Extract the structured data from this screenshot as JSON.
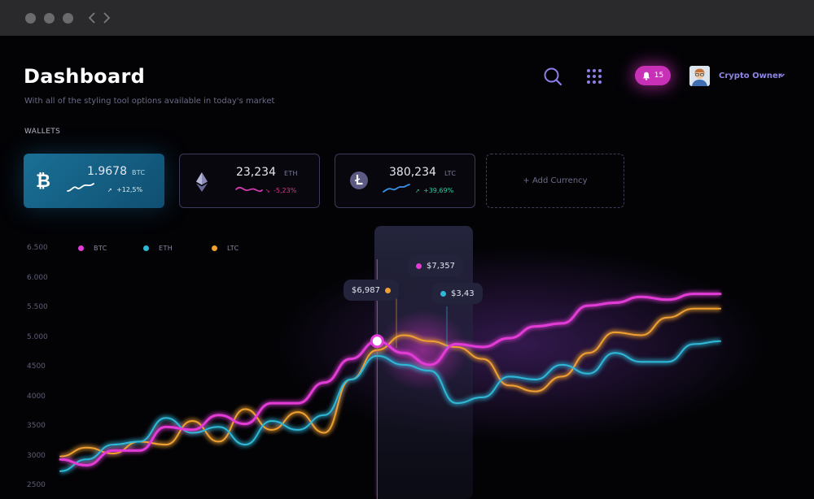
{
  "window": {
    "controls": [
      "close",
      "minimize",
      "maximize"
    ],
    "nav": [
      "back",
      "forward"
    ]
  },
  "header": {
    "title": "Dashboard",
    "subtitle": "With all of the styling tool options available in today's market",
    "search_icon": "search-icon",
    "apps_icon": "grid-icon",
    "notifications": {
      "icon": "bell-icon",
      "count": "15"
    },
    "user": {
      "name": "Crypto Owner",
      "avatar": "user-avatar"
    }
  },
  "wallets": {
    "label": "WALLETS",
    "items": [
      {
        "amount": "1.9678",
        "symbol": "BTC",
        "change": "+12,5%",
        "direction": "up",
        "icon": "bitcoin-icon",
        "color": "#ffffff"
      },
      {
        "amount": "23,234",
        "symbol": "ETH",
        "change": "-5,23%",
        "direction": "down",
        "icon": "ethereum-icon",
        "color": "#e0348f"
      },
      {
        "amount": "380,234",
        "symbol": "LTC",
        "change": "+39,69%",
        "direction": "up",
        "icon": "litecoin-icon",
        "color": "#3a9fe8"
      }
    ],
    "add_label": "+ Add Currency"
  },
  "chart_data": {
    "type": "line",
    "legend": [
      {
        "name": "BTC",
        "color": "#e23bd6"
      },
      {
        "name": "ETH",
        "color": "#2fb8d8"
      },
      {
        "name": "LTC",
        "color": "#f0a030"
      }
    ],
    "y_ticks": [
      "6.500",
      "6.000",
      "5.500",
      "5.000",
      "4500",
      "4000",
      "3500",
      "3000",
      "2500"
    ],
    "ylim": [
      2500,
      6500
    ],
    "x": [
      0,
      1,
      2,
      3,
      4,
      5,
      6,
      7,
      8,
      9,
      10,
      11,
      12,
      13,
      14,
      15,
      16,
      17,
      18,
      19,
      20,
      21,
      22,
      23,
      24,
      25
    ],
    "series": [
      {
        "name": "BTC",
        "color": "#e23bd6",
        "values": [
          2950,
          2850,
          3100,
          3100,
          3500,
          3450,
          3700,
          3550,
          3900,
          3900,
          4250,
          4650,
          4950,
          4750,
          4550,
          4900,
          4850,
          5000,
          5200,
          5250,
          5550,
          5600,
          5700,
          5650,
          5750,
          5750
        ]
      },
      {
        "name": "ETH",
        "color": "#2fb8d8",
        "values": [
          2750,
          2950,
          3200,
          3250,
          3650,
          3400,
          3500,
          3200,
          3600,
          3450,
          3700,
          4300,
          4700,
          4550,
          4450,
          3900,
          4000,
          4350,
          4300,
          4550,
          4400,
          4750,
          4600,
          4600,
          4900,
          4950
        ]
      },
      {
        "name": "LTC",
        "color": "#f0a030",
        "values": [
          3000,
          3150,
          3050,
          3250,
          3200,
          3600,
          3250,
          3800,
          3450,
          3750,
          3400,
          4300,
          4800,
          5050,
          4950,
          4850,
          4650,
          4200,
          4100,
          4350,
          4750,
          5100,
          5050,
          5350,
          5500,
          5500
        ]
      }
    ],
    "highlight": {
      "index": 12
    },
    "tooltips": [
      {
        "label": "$7,357",
        "series": "BTC"
      },
      {
        "label": "$6,987",
        "series": "LTC"
      },
      {
        "label": "$3,43",
        "series": "ETH"
      }
    ]
  }
}
